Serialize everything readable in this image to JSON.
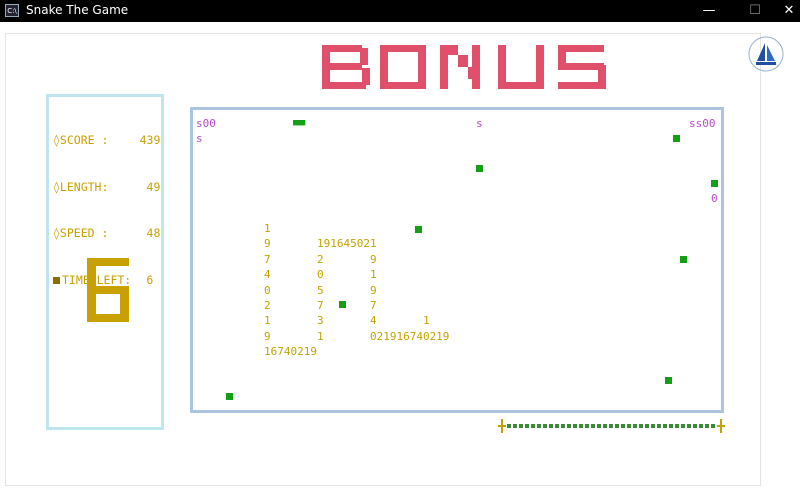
{
  "window": {
    "title": "Snake The Game",
    "icon": "console-icon",
    "controls": {
      "minimize": "—",
      "maximize": "☐",
      "close": "✕"
    }
  },
  "bonus_banner": {
    "text": "BONUS",
    "color": "#e0506a"
  },
  "stats": {
    "score_label": "◊SCORE :",
    "score_value": "439",
    "length_label": "◊LENGTH:",
    "length_value": "49",
    "speed_label": "◊SPEED :",
    "speed_value": "48",
    "time_label": "TIME LEFT:",
    "time_value": "6",
    "color": "#c8a000"
  },
  "countdown": {
    "digit": "6",
    "color": "#c8a000"
  },
  "field": {
    "top_left": "s00",
    "top_left_2": "s",
    "top_mid": "s",
    "top_right": "ss00",
    "right_glyph": "0",
    "number_rows": [
      "1",
      "9       191645021",
      "7       2       9",
      "4       0       1",
      "0       5       9",
      "2       7       7",
      "1       3       4       1",
      "9       1       021916740219",
      "16740219"
    ],
    "snake_head": "■■■"
  },
  "bonus_bar": {
    "left_cap": "┼",
    "right_cap": "┼",
    "remaining_fraction": 1.0,
    "color": "#3a8a3a"
  }
}
